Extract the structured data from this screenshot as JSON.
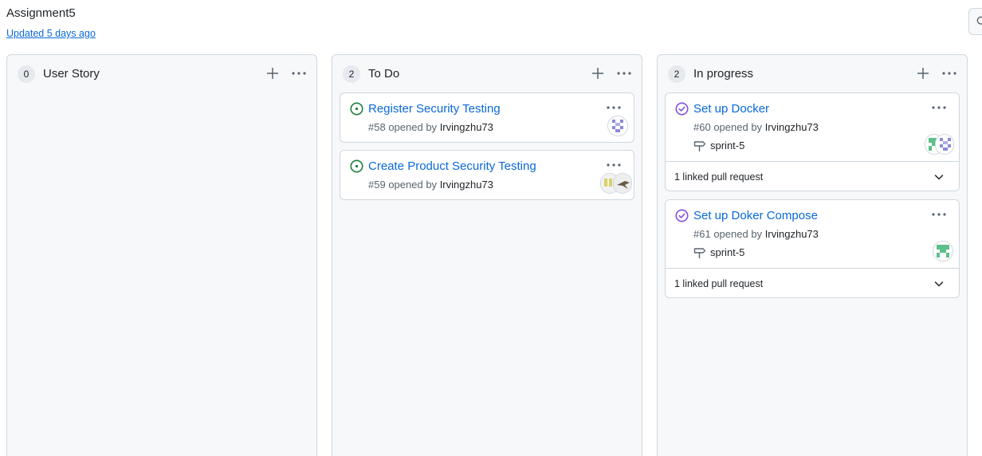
{
  "page": {
    "title": "Assignment5",
    "updated": "Updated 5 days ago"
  },
  "colors": {
    "accent_link": "#0969da",
    "open_issue_green": "#1a7f37",
    "done_issue_purple": "#8250df",
    "column_bg": "#f6f8fa",
    "border": "#d0d7de"
  },
  "columns": [
    {
      "count": "0",
      "name": "User Story",
      "cards": []
    },
    {
      "count": "2",
      "name": "To Do",
      "cards": [
        {
          "status": "open",
          "title": "Register Security Testing",
          "number": "#58",
          "opened_by": "opened by",
          "author": "Irvingzhu73"
        },
        {
          "status": "open",
          "title": "Create Product Security Testing",
          "number": "#59",
          "opened_by": "opened by",
          "author": "Irvingzhu73"
        }
      ]
    },
    {
      "count": "2",
      "name": "In progress",
      "cards": [
        {
          "status": "closed",
          "title": "Set up Docker",
          "number": "#60",
          "opened_by": "opened by",
          "author": "Irvingzhu73",
          "milestone": "sprint-5",
          "linked": "1 linked pull request"
        },
        {
          "status": "closed",
          "title": "Set up Doker Compose",
          "number": "#61",
          "opened_by": "opened by",
          "author": "Irvingzhu73",
          "milestone": "sprint-5",
          "linked": "1 linked pull request"
        }
      ]
    }
  ],
  "icons": {
    "search": "search-icon",
    "plus": "plus-icon",
    "more": "kebab-horizontal-icon",
    "issue_open": "issue-opened-icon",
    "issue_closed": "issue-closed-icon",
    "milestone": "milestone-icon",
    "chevron": "chevron-down-icon"
  }
}
